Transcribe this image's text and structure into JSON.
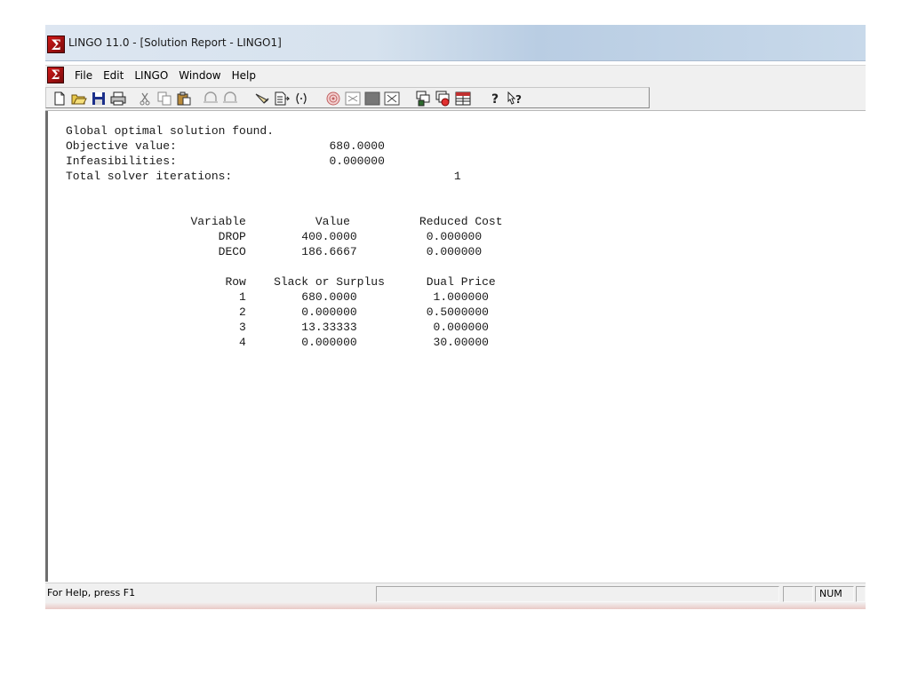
{
  "window": {
    "title": "LINGO 11.0 - [Solution Report - LINGO1]",
    "app_icon_glyph": "Σ"
  },
  "menu": {
    "items": [
      "File",
      "Edit",
      "LINGO",
      "Window",
      "Help"
    ]
  },
  "toolbar": {
    "buttons": [
      "new-file-icon",
      "open-folder-icon",
      "save-icon",
      "print-icon",
      "cut-icon",
      "copy-icon",
      "paste-icon",
      "undo-icon",
      "redo-icon",
      "find-icon",
      "goto-line-icon",
      "match-parenthesis-icon",
      "solve-icon",
      "solution-icon",
      "close-all-icon",
      "send-to-back-icon",
      "tile-icon",
      "cascade-icon",
      "grid-icon",
      "help-icon",
      "context-help-icon"
    ]
  },
  "report": {
    "status": {
      "label": "Global optimal solution found.",
      "objective_label": "Objective value:",
      "objective_value": "680.0000",
      "infeasibilities_label": "Infeasibilities:",
      "infeasibilities_value": "0.000000",
      "iterations_label": "Total solver iterations:",
      "iterations_value": "1"
    },
    "variables": {
      "headers": [
        "Variable",
        "Value",
        "Reduced Cost"
      ],
      "rows": [
        [
          "DROP",
          "400.0000",
          "0.000000"
        ],
        [
          "DECO",
          "186.6667",
          "0.000000"
        ]
      ]
    },
    "rows_table": {
      "headers": [
        "Row",
        "Slack or Surplus",
        "Dual Price"
      ],
      "rows": [
        [
          "1",
          "680.0000",
          "1.000000"
        ],
        [
          "2",
          "0.000000",
          "0.5000000"
        ],
        [
          "3",
          "13.33333",
          "0.000000"
        ],
        [
          "4",
          "0.000000",
          "30.00000"
        ]
      ]
    }
  },
  "statusbar": {
    "help_text": "For Help, press F1",
    "num_indicator": "NUM"
  },
  "colors": {
    "titlebar": "#d6e2ee",
    "chrome": "#f0f0f0",
    "app_icon_red": "#d01818"
  }
}
